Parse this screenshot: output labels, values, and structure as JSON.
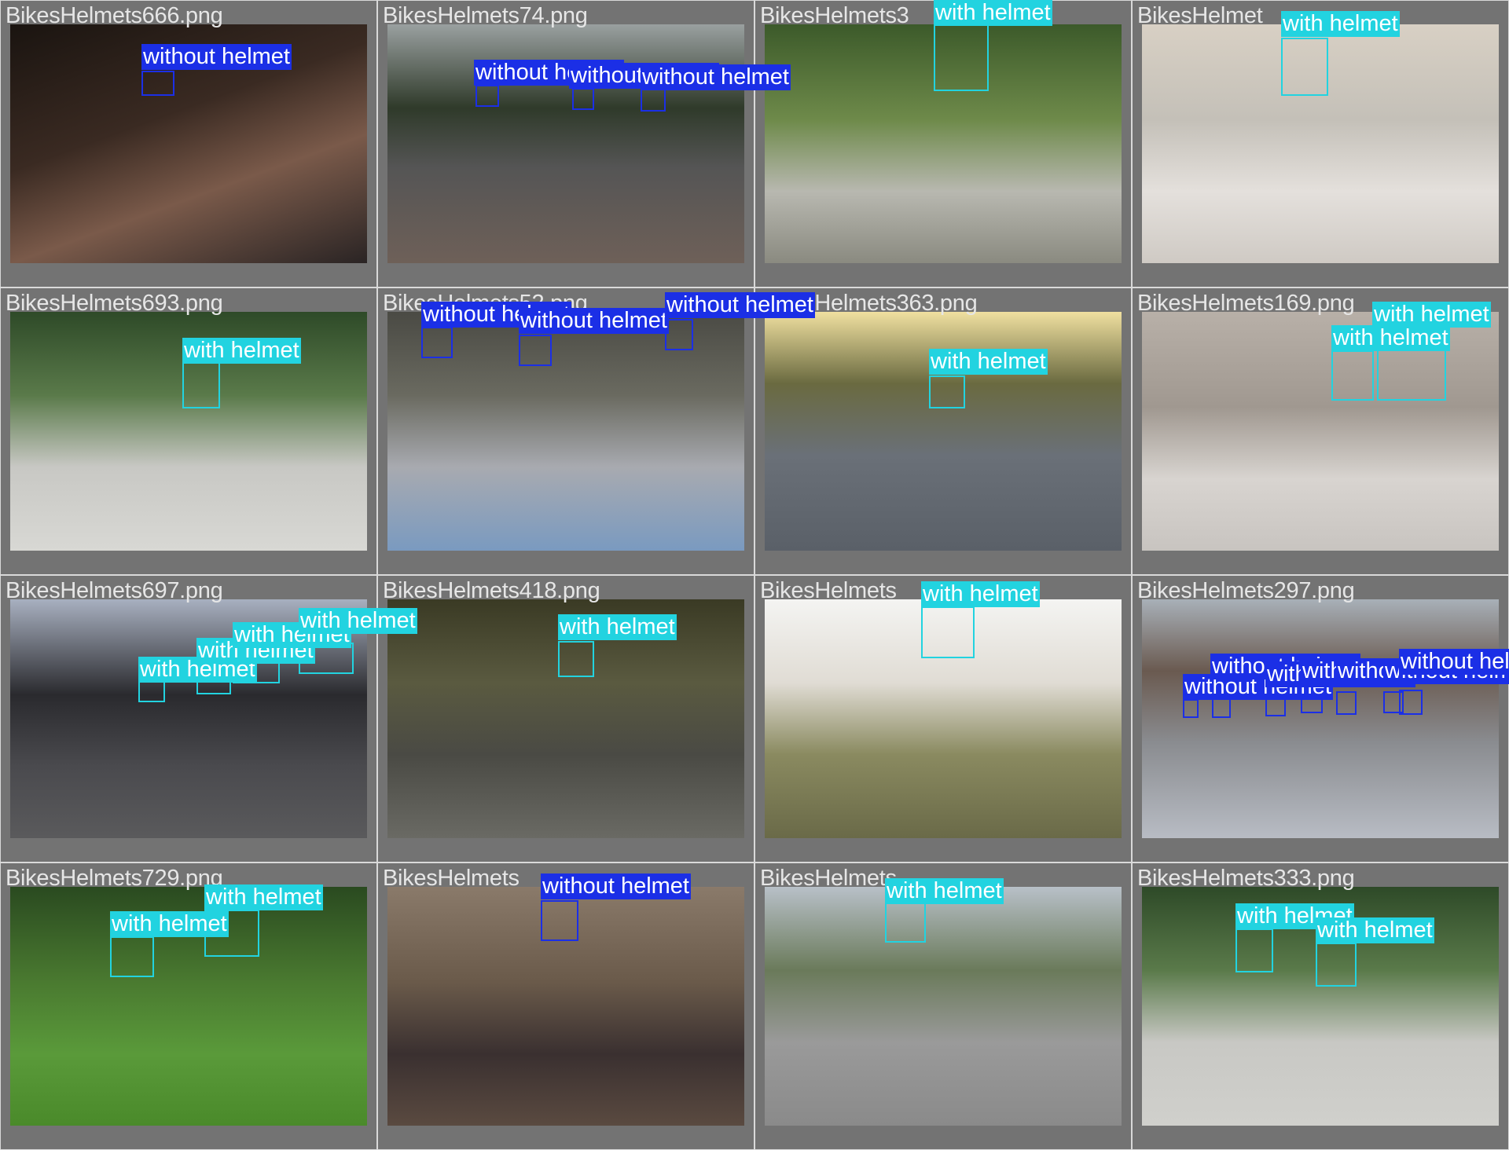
{
  "classes": {
    "with": {
      "name": "with helmet",
      "color": "#22d3e0"
    },
    "without": {
      "name": "without helmet",
      "color": "#1b2fe6"
    }
  },
  "tiles": [
    {
      "name": "BikesHelmets666.png",
      "bg": "linear-gradient(160deg,#1a1410 0%,#3a2a22 40%,#7a5a4a 65%,#2a2424 100%)",
      "labels": [
        "without"
      ]
    },
    {
      "name": "BikesHelmets74.png",
      "bg": "linear-gradient(180deg,#9aa0a0 0%,#2f3a2a 35%,#555 60%,#6e6058 100%)",
      "labels": [
        "without",
        "without",
        "without"
      ]
    },
    {
      "name": "BikesHelmets3",
      "bg": "linear-gradient(180deg,#3c5a2a 0%,#6e8a4a 40%,#b8b8b0 70%,#8a8a80 100%)",
      "labels": [
        "with"
      ]
    },
    {
      "name": "BikesHelmet",
      "bg": "linear-gradient(180deg,#d8d0c4 0%,#c4c0b8 40%,#e4e0dc 70%,#cfcac4 100%)",
      "labels": [
        "with"
      ]
    },
    {
      "name": "BikesHelmets693.png",
      "bg": "linear-gradient(180deg,#2e4a28 0%,#5a7a4a 35%,#c8c8c4 65%,#d8d8d4 100%)",
      "labels": [
        "with"
      ]
    },
    {
      "name": "BikesHelmets52.png",
      "bg": "linear-gradient(180deg,#4a4a44 0%,#6a6a60 35%,#a8aab0 65%,#7a9ac0 100%)",
      "labels": [
        "without",
        "without",
        "without"
      ]
    },
    {
      "name": "BikesHelmets363.png",
      "bg": "linear-gradient(180deg,#f0e0a0 0%,#6a6a40 30%,#6a7078 60%,#5a6068 100%)",
      "labels": [
        "with"
      ]
    },
    {
      "name": "BikesHelmets169.png",
      "bg": "linear-gradient(180deg,#b8b0a8 0%,#a09890 40%,#d8d4d0 70%,#c8c4c0 100%)",
      "labels": [
        "with",
        "with"
      ]
    },
    {
      "name": "BikesHelmets697.png",
      "bg": "linear-gradient(180deg,#a8b0c0 0%,#2a2a2e 40%,#4a4a4e 70%,#5a5a5c 100%)",
      "labels": [
        "with",
        "with",
        "with",
        "with"
      ]
    },
    {
      "name": "BikesHelmets418.png",
      "bg": "linear-gradient(180deg,#3a3a24 0%,#5a5a40 35%,#4a4a44 65%,#6a6a64 100%)",
      "labels": [
        "with"
      ]
    },
    {
      "name": "BikesHelmets",
      "bg": "linear-gradient(180deg,#f4f4f2 0%,#e0dcd4 35%,#8a8a60 65%,#6a6a48 100%)",
      "labels": [
        "with"
      ]
    },
    {
      "name": "BikesHelmets297.png",
      "bg": "linear-gradient(180deg,#a8b0b8 0%,#6a5a50 30%,#8a8c90 60%,#b8bcc4 100%)",
      "labels": [
        "without",
        "without",
        "without",
        "without",
        "without",
        "without",
        "without"
      ]
    },
    {
      "name": "BikesHelmets729.png",
      "bg": "linear-gradient(180deg,#2a4a20 0%,#4a7a30 40%,#5a9a3a 70%,#4a8a2a 100%)",
      "labels": [
        "with",
        "with"
      ]
    },
    {
      "name": "BikesHelmets",
      "bg": "linear-gradient(180deg,#8a7a6a 0%,#6a5a4a 40%,#3a3030 70%,#5a4a40 100%)",
      "labels": [
        "without"
      ]
    },
    {
      "name": "BikesHelmets",
      "bg": "linear-gradient(180deg,#b8c0c8 0%,#6a7a5a 35%,#9a9a9a 65%,#8a8a8a 100%)",
      "labels": [
        "with"
      ]
    },
    {
      "name": "BikesHelmets333.png",
      "bg": "linear-gradient(180deg,#2e4a28 0%,#5a7a4a 35%,#c8c8c4 65%,#d0d0cc 100%)",
      "labels": [
        "with",
        "with"
      ]
    }
  ]
}
